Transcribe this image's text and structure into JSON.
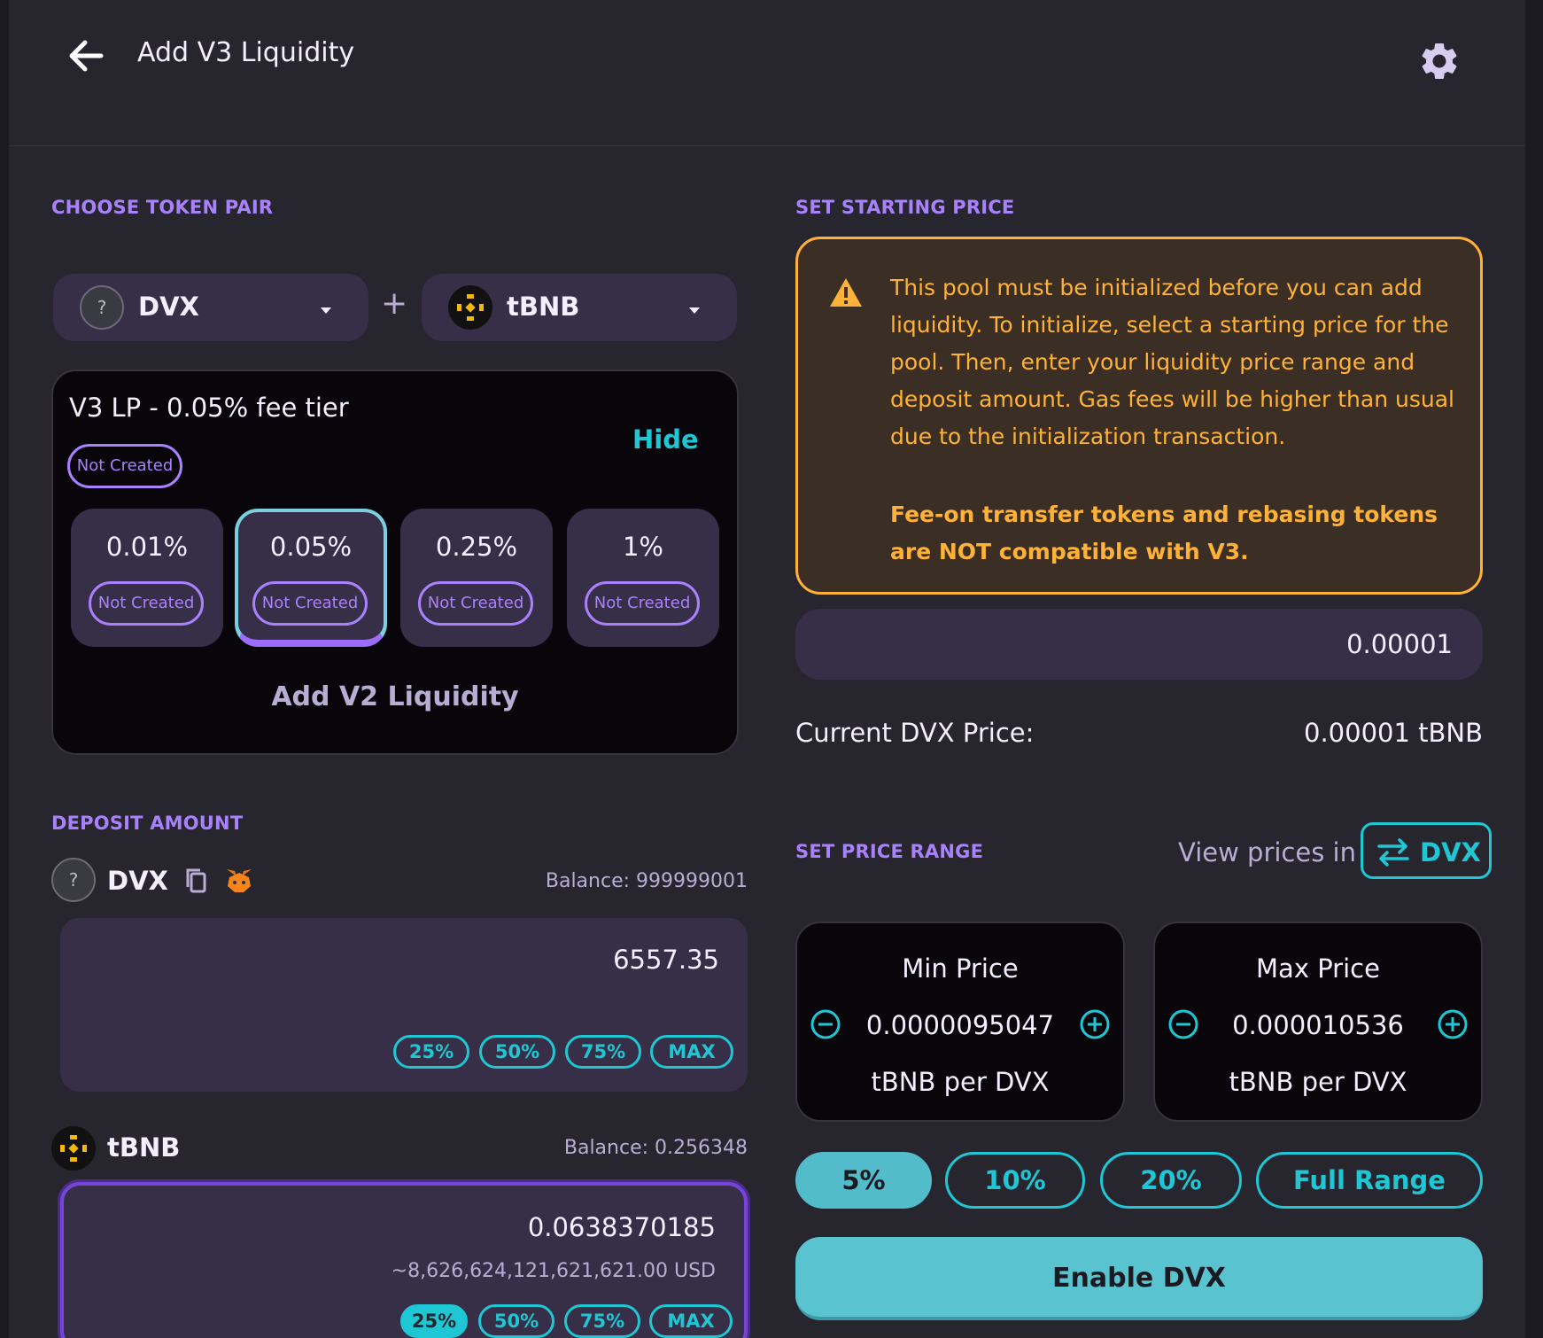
{
  "header": {
    "title": "Add V3 Liquidity"
  },
  "token_pair": {
    "section_label": "CHOOSE TOKEN PAIR",
    "token_a": "DVX",
    "token_b": "tBNB",
    "plus": "+"
  },
  "fee_card": {
    "title": "V3 LP - 0.05% fee tier",
    "status": "Not Created",
    "hide_label": "Hide",
    "tiers": [
      {
        "pct": "0.01%",
        "status": "Not Created"
      },
      {
        "pct": "0.05%",
        "status": "Not Created"
      },
      {
        "pct": "0.25%",
        "status": "Not Created"
      },
      {
        "pct": "1%",
        "status": "Not Created"
      }
    ],
    "selected_tier": "0.05%",
    "add_v2_label": "Add V2 Liquidity"
  },
  "deposit": {
    "section_label": "DEPOSIT AMOUNT",
    "token_a": {
      "name": "DVX",
      "balance": "Balance: 999999001",
      "value": "6557.35",
      "quick": [
        "25%",
        "50%",
        "75%",
        "MAX"
      ]
    },
    "token_b": {
      "name": "tBNB",
      "balance": "Balance: 0.256348",
      "value": "0.0638370185",
      "usd": "~8,626,624,121,621,621.00 USD",
      "quick": [
        "25%",
        "50%",
        "75%",
        "MAX"
      ],
      "quick_selected": "25%"
    }
  },
  "starting_price": {
    "section_label": "SET STARTING PRICE",
    "warning": "This pool must be initialized before you can add liquidity. To initialize, select a starting price for the pool. Then, enter your liquidity price range and deposit amount. Gas fees will be higher than usual due to the initialization transaction.",
    "warning_bold": "Fee-on transfer tokens and rebasing tokens are NOT compatible with V3.",
    "input_value": "0.00001",
    "current_label": "Current DVX Price:",
    "current_value": "0.00001 tBNB"
  },
  "price_range": {
    "section_label": "SET PRICE RANGE",
    "view_in_label": "View prices in",
    "view_in_token": "DVX",
    "min": {
      "title": "Min Price",
      "value": "0.0000095047",
      "unit": "tBNB per DVX"
    },
    "max": {
      "title": "Max Price",
      "value": "0.000010536",
      "unit": "tBNB per DVX"
    },
    "presets": [
      "5%",
      "10%",
      "20%",
      "Full Range"
    ],
    "preset_selected": "5%"
  },
  "enable_button": "Enable DVX",
  "colors": {
    "accent": "#1fc7d4",
    "purple": "#a881fc",
    "warning": "#ffb237",
    "background": "#27262e"
  }
}
